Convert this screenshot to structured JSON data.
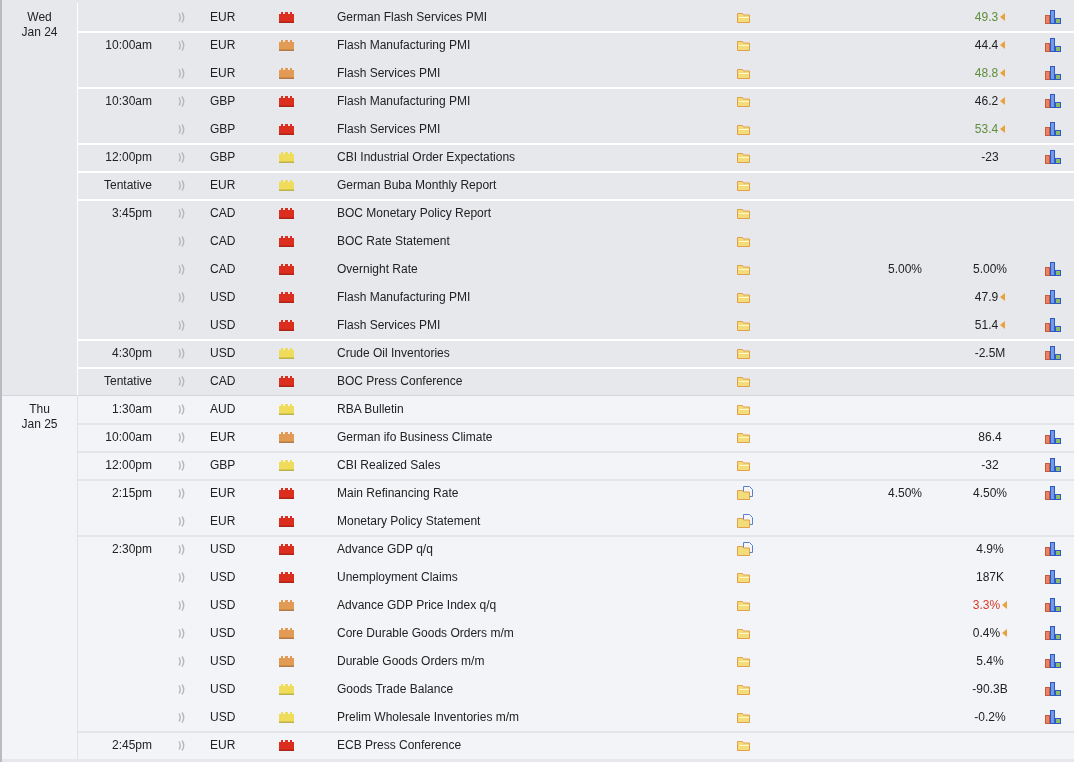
{
  "days": [
    {
      "day": "Wed",
      "date": "Jan 24",
      "today": true,
      "groups": [
        {
          "rows": [
            {
              "currency": "EUR",
              "color": "#dc2e1f",
              "event": "German Flash Services PMI",
              "kind": "folder",
              "previous": "49.3",
              "better": true,
              "worse": false,
              "revised": true,
              "chart": true
            }
          ]
        },
        {
          "time": "10:00am",
          "rows": [
            {
              "currency": "EUR",
              "color": "#e29a55",
              "event": "Flash Manufacturing PMI",
              "kind": "folder",
              "previous": "44.4",
              "better": false,
              "worse": false,
              "revised": true,
              "chart": true
            },
            {
              "currency": "EUR",
              "color": "#e29a55",
              "event": "Flash Services PMI",
              "kind": "folder",
              "previous": "48.8",
              "better": true,
              "worse": false,
              "revised": true,
              "chart": true
            }
          ]
        },
        {
          "time": "10:30am",
          "rows": [
            {
              "currency": "GBP",
              "color": "#dc2e1f",
              "event": "Flash Manufacturing PMI",
              "kind": "folder",
              "previous": "46.2",
              "better": false,
              "worse": false,
              "revised": true,
              "chart": true
            },
            {
              "currency": "GBP",
              "color": "#dc2e1f",
              "event": "Flash Services PMI",
              "kind": "folder",
              "previous": "53.4",
              "better": true,
              "worse": false,
              "revised": true,
              "chart": true
            }
          ]
        },
        {
          "time": "12:00pm",
          "rows": [
            {
              "currency": "GBP",
              "color": "#efdc5a",
              "event": "CBI Industrial Order Expectations",
              "kind": "folder",
              "previous": "-23",
              "better": false,
              "worse": false,
              "revised": false,
              "chart": true
            }
          ]
        },
        {
          "time": "Tentative",
          "rows": [
            {
              "currency": "EUR",
              "color": "#efdc5a",
              "event": "German Buba Monthly Report",
              "kind": "folder",
              "revised": false,
              "chart": false
            }
          ]
        },
        {
          "time": "3:45pm",
          "rows": [
            {
              "currency": "CAD",
              "color": "#dc2e1f",
              "event": "BOC Monetary Policy Report",
              "kind": "folder",
              "revised": false,
              "chart": false
            },
            {
              "currency": "CAD",
              "color": "#dc2e1f",
              "event": "BOC Rate Statement",
              "kind": "folder",
              "revised": false,
              "chart": false
            },
            {
              "currency": "CAD",
              "color": "#dc2e1f",
              "event": "Overnight Rate",
              "kind": "folder",
              "forecast": "5.00%",
              "previous": "5.00%",
              "better": false,
              "worse": false,
              "revised": false,
              "chart": true
            },
            {
              "currency": "USD",
              "color": "#dc2e1f",
              "event": "Flash Manufacturing PMI",
              "kind": "folder",
              "previous": "47.9",
              "better": false,
              "worse": false,
              "revised": true,
              "chart": true
            },
            {
              "currency": "USD",
              "color": "#dc2e1f",
              "event": "Flash Services PMI",
              "kind": "folder",
              "previous": "51.4",
              "better": false,
              "worse": false,
              "revised": true,
              "chart": true
            }
          ]
        },
        {
          "time": "4:30pm",
          "rows": [
            {
              "currency": "USD",
              "color": "#efdc5a",
              "event": "Crude Oil Inventories",
              "kind": "folder",
              "previous": "-2.5M",
              "better": false,
              "worse": false,
              "revised": false,
              "chart": true
            }
          ]
        },
        {
          "time": "Tentative",
          "rows": [
            {
              "currency": "CAD",
              "color": "#dc2e1f",
              "event": "BOC Press Conference",
              "kind": "folder",
              "revised": false,
              "chart": false
            }
          ]
        }
      ]
    },
    {
      "day": "Thu",
      "date": "Jan 25",
      "today": false,
      "groups": [
        {
          "time": "1:30am",
          "rows": [
            {
              "currency": "AUD",
              "color": "#efdc5a",
              "event": "RBA Bulletin",
              "kind": "folder",
              "revised": false,
              "chart": false
            }
          ]
        },
        {
          "time": "10:00am",
          "rows": [
            {
              "currency": "EUR",
              "color": "#e29a55",
              "event": "German ifo Business Climate",
              "kind": "folder",
              "previous": "86.4",
              "better": false,
              "worse": false,
              "revised": false,
              "chart": true
            }
          ]
        },
        {
          "time": "12:00pm",
          "rows": [
            {
              "currency": "GBP",
              "color": "#efdc5a",
              "event": "CBI Realized Sales",
              "kind": "folder",
              "previous": "-32",
              "better": false,
              "worse": false,
              "revised": false,
              "chart": true
            }
          ]
        },
        {
          "time": "2:15pm",
          "rows": [
            {
              "currency": "EUR",
              "color": "#dc2e1f",
              "event": "Main Refinancing Rate",
              "kind": "folder-doc",
              "forecast": "4.50%",
              "previous": "4.50%",
              "better": false,
              "worse": false,
              "revised": false,
              "chart": true
            },
            {
              "currency": "EUR",
              "color": "#dc2e1f",
              "event": "Monetary Policy Statement",
              "kind": "folder-doc",
              "revised": false,
              "chart": false
            }
          ]
        },
        {
          "time": "2:30pm",
          "rows": [
            {
              "currency": "USD",
              "color": "#dc2e1f",
              "event": "Advance GDP q/q",
              "kind": "folder-doc",
              "previous": "4.9%",
              "better": false,
              "worse": false,
              "revised": false,
              "chart": true
            },
            {
              "currency": "USD",
              "color": "#dc2e1f",
              "event": "Unemployment Claims",
              "kind": "folder",
              "previous": "187K",
              "better": false,
              "worse": false,
              "revised": false,
              "chart": true
            },
            {
              "currency": "USD",
              "color": "#e29a55",
              "event": "Advance GDP Price Index q/q",
              "kind": "folder",
              "previous": "3.3%",
              "better": false,
              "worse": true,
              "revised": true,
              "chart": true
            },
            {
              "currency": "USD",
              "color": "#e29a55",
              "event": "Core Durable Goods Orders m/m",
              "kind": "folder",
              "previous": "0.4%",
              "better": false,
              "worse": false,
              "revised": true,
              "chart": true
            },
            {
              "currency": "USD",
              "color": "#e29a55",
              "event": "Durable Goods Orders m/m",
              "kind": "folder",
              "previous": "5.4%",
              "better": false,
              "worse": false,
              "revised": false,
              "chart": true
            },
            {
              "currency": "USD",
              "color": "#efdc5a",
              "event": "Goods Trade Balance",
              "kind": "folder",
              "previous": "-90.3B",
              "better": false,
              "worse": false,
              "revised": false,
              "chart": true
            },
            {
              "currency": "USD",
              "color": "#efdc5a",
              "event": "Prelim Wholesale Inventories m/m",
              "kind": "folder",
              "previous": "-0.2%",
              "better": false,
              "worse": false,
              "revised": false,
              "chart": true
            }
          ]
        },
        {
          "time": "2:45pm",
          "rows": [
            {
              "currency": "EUR",
              "color": "#dc2e1f",
              "event": "ECB Press Conference",
              "kind": "folder",
              "revised": false,
              "chart": false
            }
          ]
        }
      ]
    }
  ]
}
